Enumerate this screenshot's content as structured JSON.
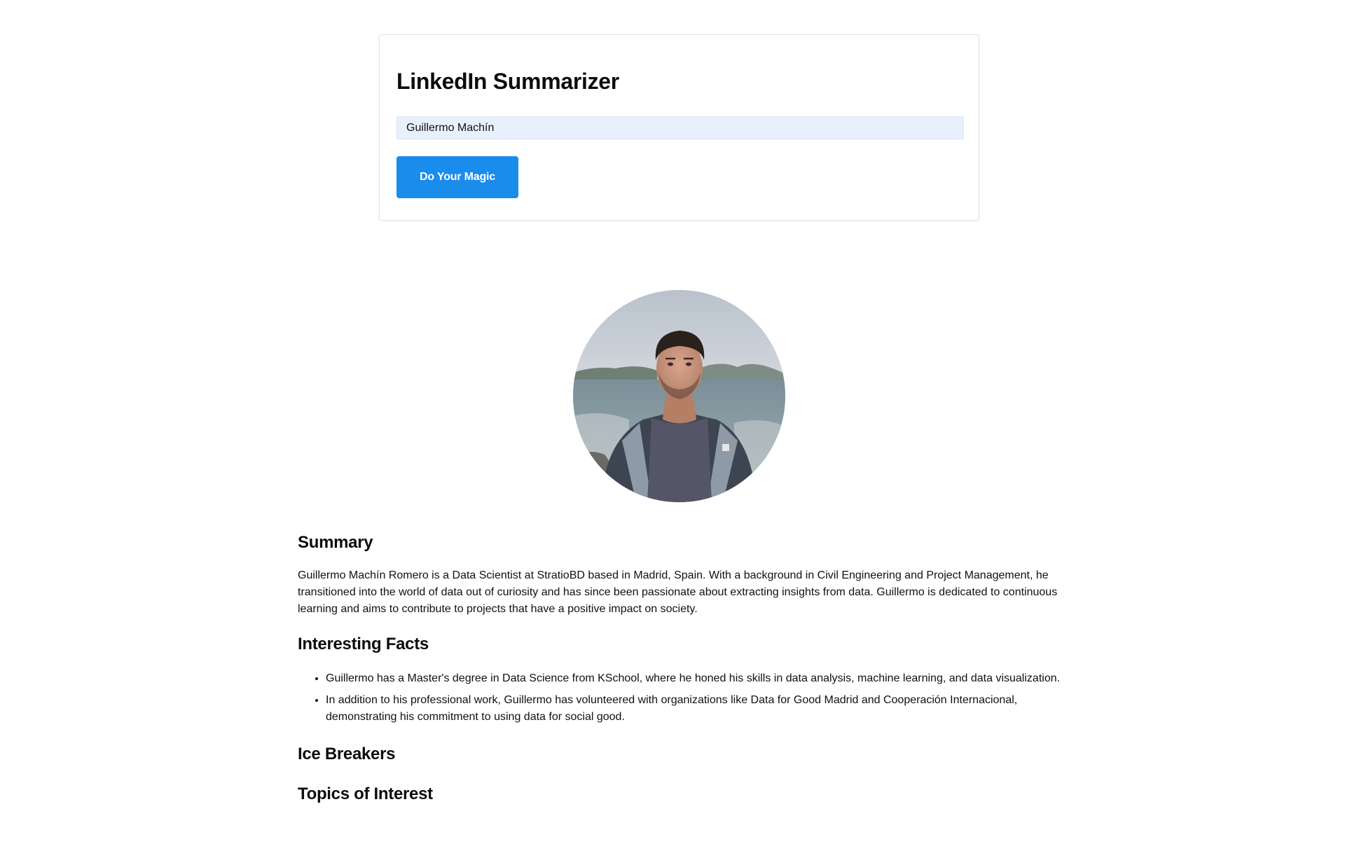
{
  "app": {
    "title": "LinkedIn Summarizer"
  },
  "form": {
    "name_value": "Guillermo Machín",
    "button_label": "Do Your Magic"
  },
  "profile": {
    "photo_alt": "Guillermo Machín profile photo"
  },
  "summary": {
    "heading": "Summary",
    "text": "Guillermo Machín Romero is a Data Scientist at StratioBD based in Madrid, Spain. With a background in Civil Engineering and Project Management, he transitioned into the world of data out of curiosity and has since been passionate about extracting insights from data. Guillermo is dedicated to continuous learning and aims to contribute to projects that have a positive impact on society."
  },
  "facts": {
    "heading": "Interesting Facts",
    "items": [
      "Guillermo has a Master's degree in Data Science from KSchool, where he honed his skills in data analysis, machine learning, and data visualization.",
      "In addition to his professional work, Guillermo has volunteered with organizations like Data for Good Madrid and Cooperación Internacional, demonstrating his commitment to using data for social good."
    ]
  },
  "ice_breakers": {
    "heading": "Ice Breakers"
  },
  "topics": {
    "heading": "Topics of Interest"
  },
  "colors": {
    "button": "#1a8cec",
    "input_background": "#e8f0fe"
  }
}
